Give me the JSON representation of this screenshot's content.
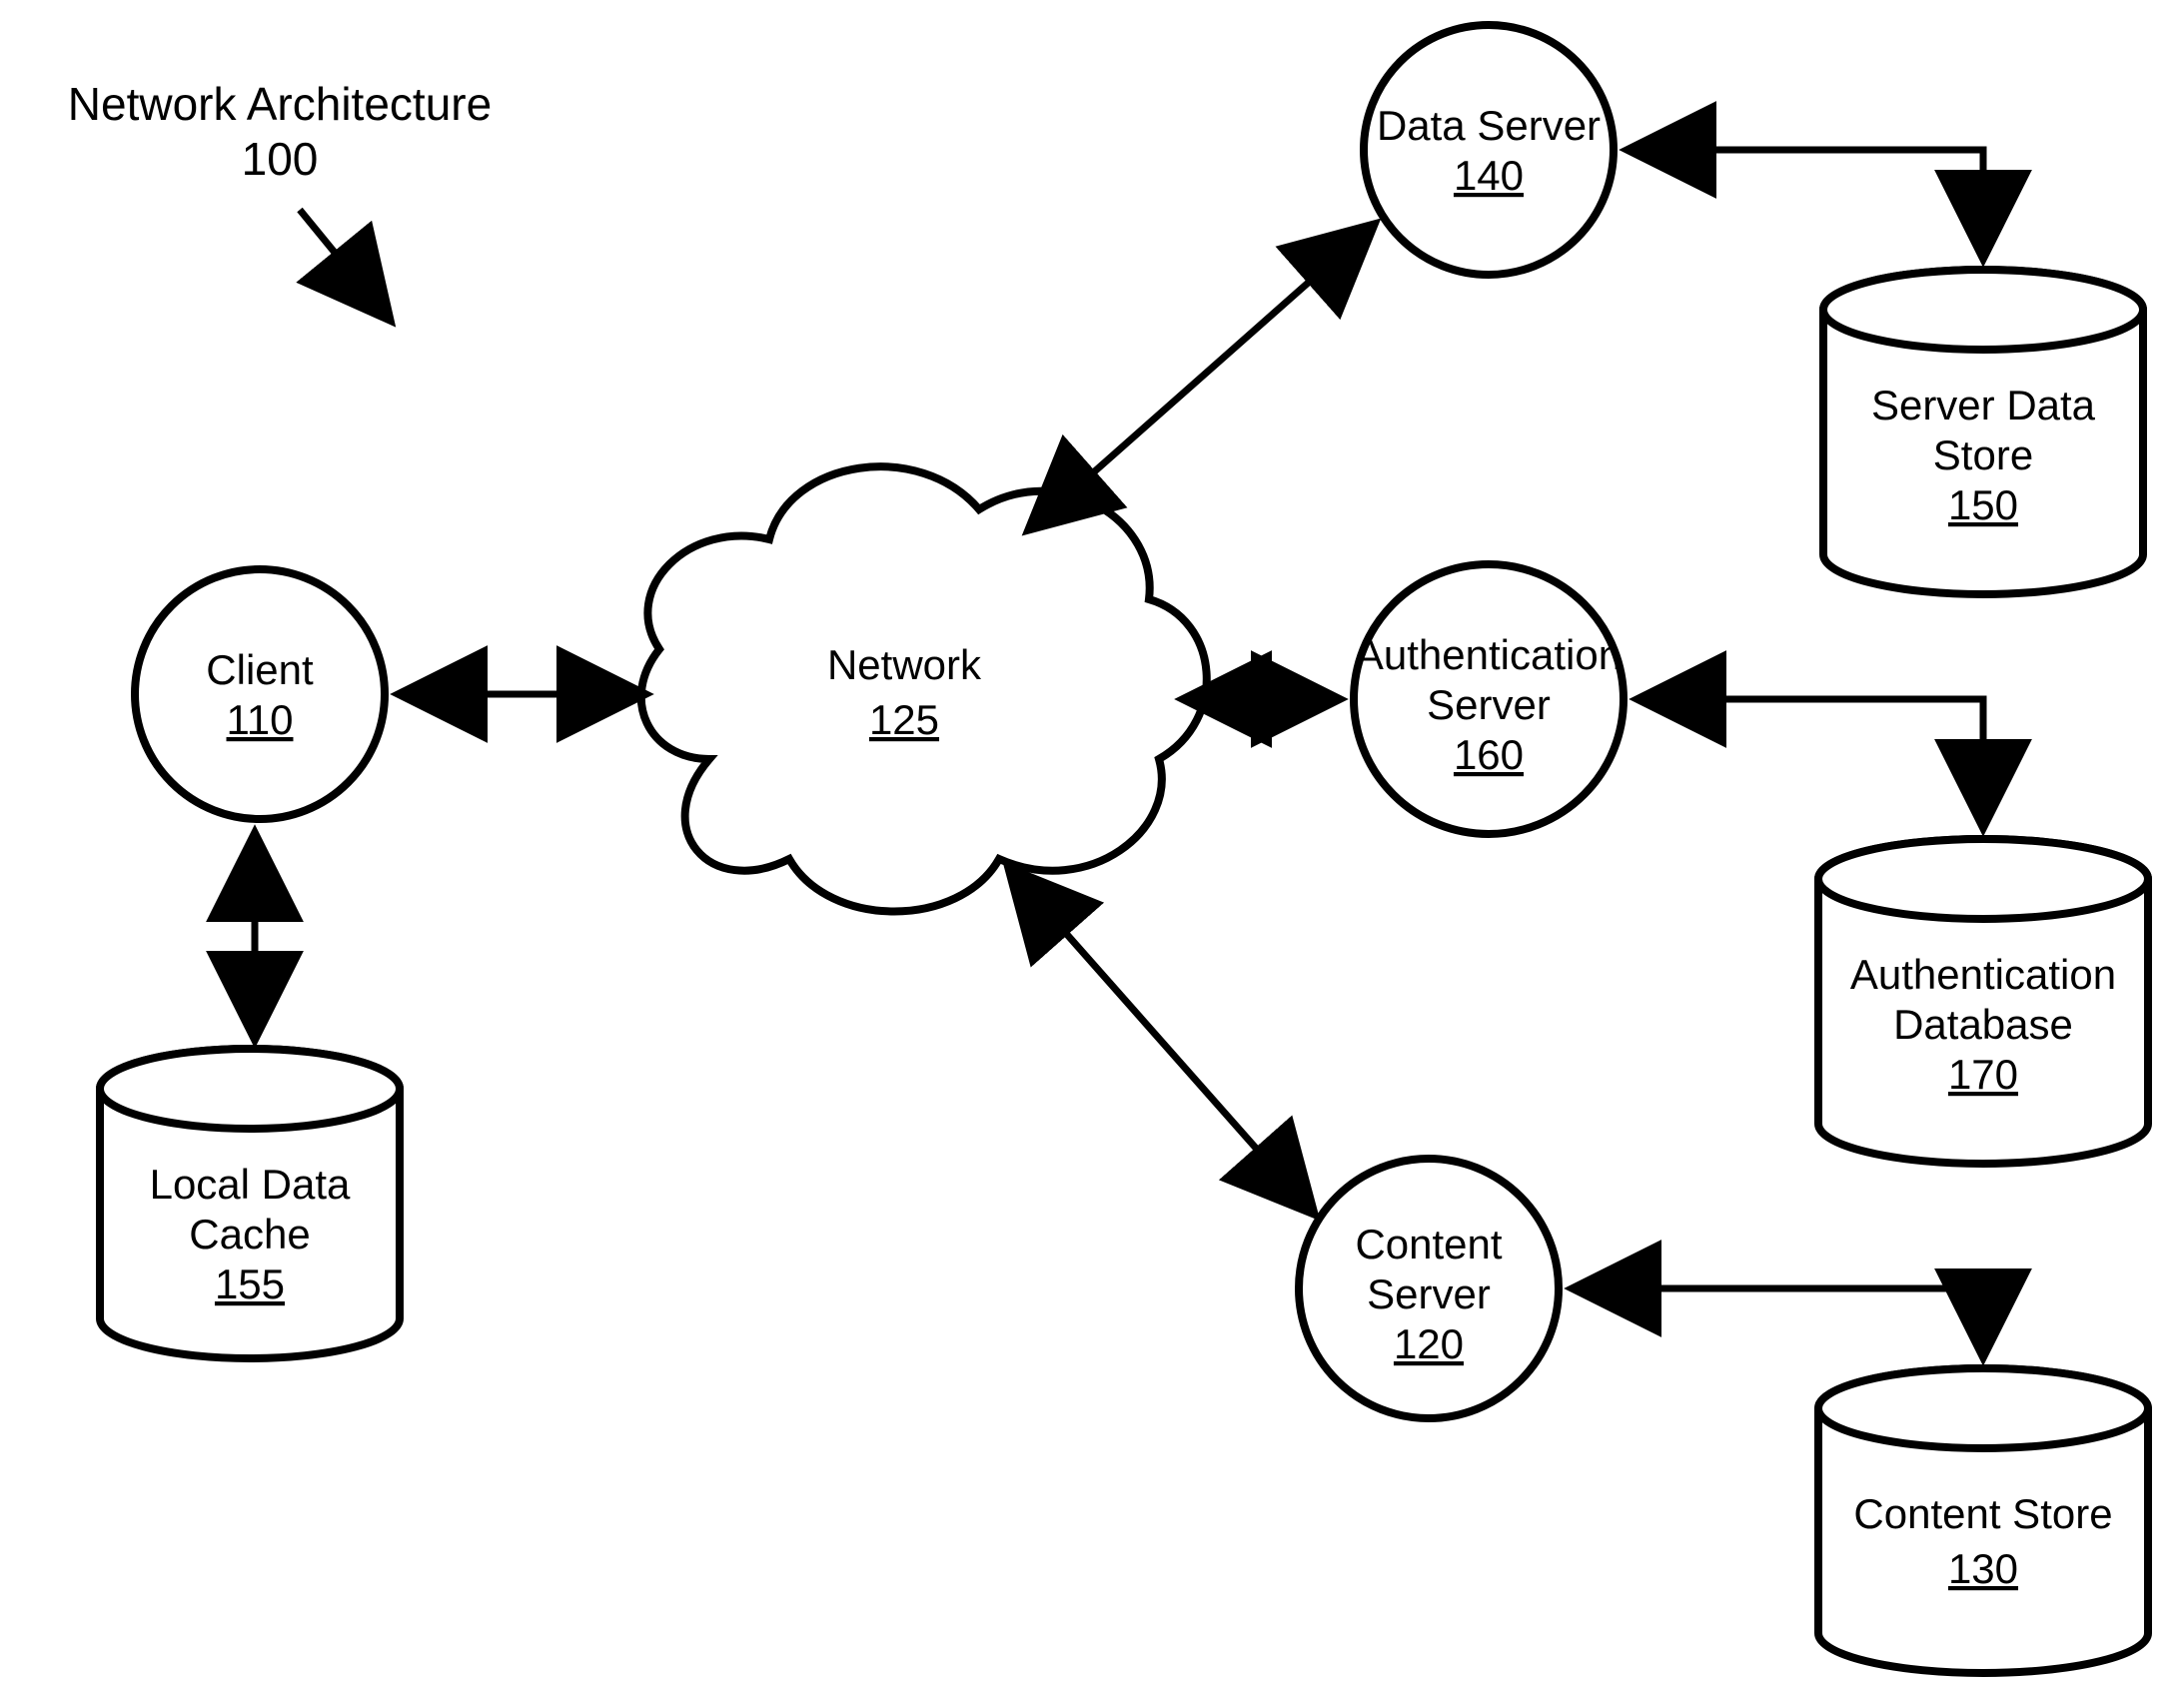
{
  "title": {
    "label": "Network Architecture",
    "num": "100"
  },
  "nodes": {
    "client": {
      "label": "Client",
      "num": "110"
    },
    "network": {
      "label": "Network",
      "num": "125"
    },
    "dataServer": {
      "label": "Data Server",
      "num": "140"
    },
    "authServer": {
      "line1": "Authentication",
      "line2": "Server",
      "num": "160"
    },
    "contentServer": {
      "line1": "Content",
      "line2": "Server",
      "num": "120"
    },
    "localCache": {
      "line1": "Local Data",
      "line2": "Cache",
      "num": "155"
    },
    "serverStore": {
      "line1": "Server Data",
      "line2": "Store",
      "num": "150"
    },
    "authDb": {
      "line1": "Authentication",
      "line2": "Database",
      "num": "170"
    },
    "contentStore": {
      "label": "Content Store",
      "num": "130"
    }
  }
}
